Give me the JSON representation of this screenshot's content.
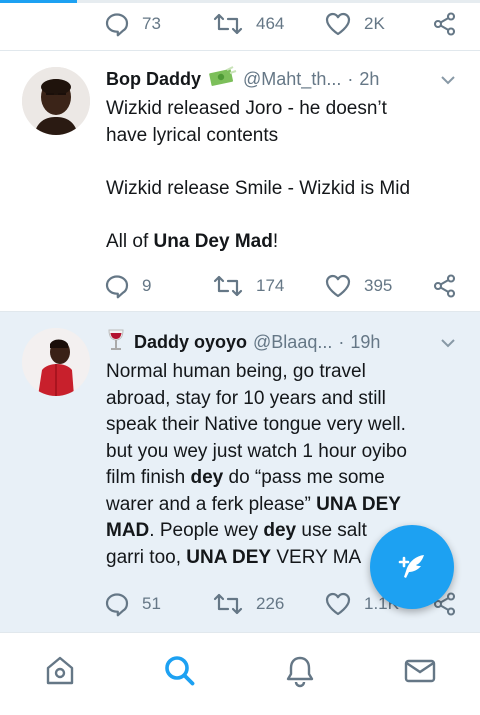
{
  "progress": {
    "fraction": 0.16
  },
  "top_actions": {
    "replies": "73",
    "retweets": "464",
    "likes": "2K"
  },
  "tweets": [
    {
      "name": "Bop Daddy",
      "badge_icon": "money-with-wings-emoji",
      "handle": "@Maht_th...",
      "separator": "·",
      "time": "2h",
      "line1": "Wizkid released Joro - he doesn’t",
      "line2": "have lyrical contents",
      "line3": "Wizkid release Smile - Wizkid is Mid",
      "line4_prefix": "All of ",
      "line4_bold": "Una Dey Mad",
      "line4_suffix": "!",
      "replies": "9",
      "retweets": "174",
      "likes": "395"
    },
    {
      "name": "Daddy oyoyo",
      "badge_icon": "wine-glass-emoji",
      "handle": "@Blaaq...",
      "separator": "·",
      "time": "19h",
      "t1": "Normal human being, go travel",
      "t2": "abroad, stay for 10 years and still",
      "t3": "speak their Native tongue very well.",
      "t4": "but you wey just watch 1 hour oyibo",
      "t5a": "film finish ",
      "t5b": "dey",
      "t5c": " do “pass me some",
      "t6a": "warer and a ferk please” ",
      "t6b": "UNA DEY",
      "t7a": "MAD",
      "t7b": ". People wey ",
      "t7c": "dey",
      "t7d": " use salt",
      "t8a": "garri too, ",
      "t8b": "UNA DEY",
      "t8c": " VERY MA",
      "replies": "51",
      "retweets": "226",
      "likes": "1.1K"
    }
  ],
  "fab": {
    "icon": "compose-feather-icon"
  },
  "tabbar": [
    "home-icon",
    "search-icon",
    "notifications-bell-icon",
    "messages-envelope-icon"
  ],
  "colors": {
    "accent": "#1da1f2",
    "highlight_bg": "#e8f0f7",
    "muted": "#657786"
  }
}
